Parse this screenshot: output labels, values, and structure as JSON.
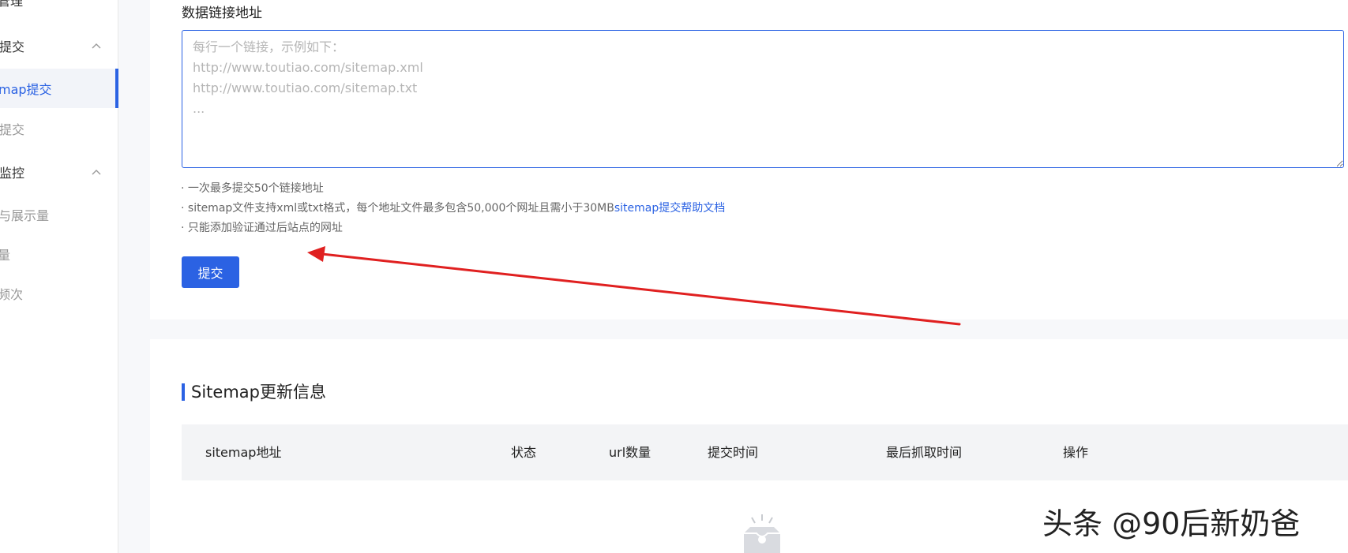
{
  "sidebar": {
    "items": [
      {
        "label": "管理",
        "type": "group",
        "chevron": false
      },
      {
        "label": "提交",
        "type": "group",
        "chevron": true
      },
      {
        "label": "map提交",
        "type": "active"
      },
      {
        "label": "提交",
        "type": "sub"
      },
      {
        "label": "监控",
        "type": "group",
        "chevron": true
      },
      {
        "label": "与展示量",
        "type": "sub"
      },
      {
        "label": "量",
        "type": "sub"
      },
      {
        "label": "频次",
        "type": "sub"
      }
    ]
  },
  "form": {
    "label": "数据链接地址",
    "textarea_placeholder": "每行一个链接，示例如下：\nhttp://www.toutiao.com/sitemap.xml\nhttp://www.toutiao.com/sitemap.txt\n...",
    "notes": {
      "line1": "· 一次最多提交50个链接地址",
      "line2_text": "· sitemap文件支持xml或txt格式，每个地址文件最多包含50,000个网址且需小于30MB",
      "line2_link": "sitemap提交帮助文档",
      "line3": "· 只能添加验证通过后站点的网址"
    },
    "submit_label": "提交"
  },
  "sitemap_section": {
    "title": "Sitemap更新信息",
    "columns": [
      "sitemap地址",
      "状态",
      "url数量",
      "提交时间",
      "最后抓取时间",
      "操作"
    ]
  },
  "watermark": "头条 @90后新奶爸",
  "colors": {
    "accent": "#2b62e3",
    "arrow": "#e02020"
  }
}
